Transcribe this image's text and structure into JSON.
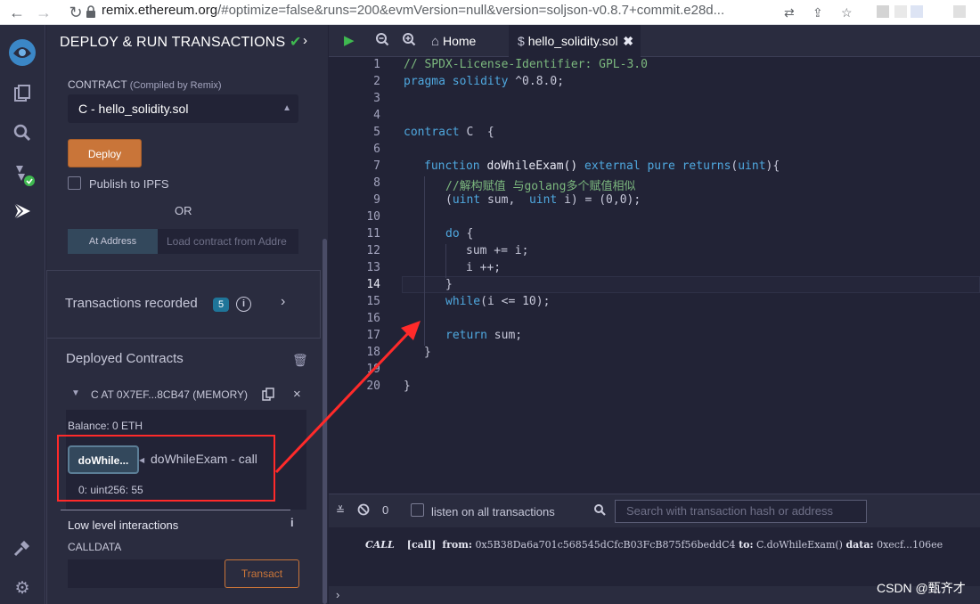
{
  "browser": {
    "url_host": "remix.ethereum.org",
    "url_rest": "/#optimize=false&runs=200&evmVersion=null&version=soljson-v0.8.7+commit.e28d..."
  },
  "panel": {
    "title": "DEPLOY & RUN TRANSACTIONS",
    "contract_label": "CONTRACT",
    "contract_sub": "(Compiled by Remix)",
    "contract_value": "C - hello_solidity.sol",
    "deploy_label": "Deploy",
    "publish_label": "Publish to IPFS",
    "or_label": "OR",
    "at_address_label": "At Address",
    "at_address_placeholder": "Load contract from Addre",
    "tx_recorded_label": "Transactions recorded",
    "tx_recorded_count": "5",
    "deployed_label": "Deployed Contracts",
    "instance_label": "C AT 0X7EF...8CB47 (MEMORY)",
    "balance_label": "Balance: 0 ETH",
    "call_button_label": "doWhile...",
    "call_desc": "doWhileExam - call",
    "call_result": "0: uint256: 55",
    "low_level_label": "Low level interactions",
    "calldata_label": "CALLDATA",
    "transact_label": "Transact"
  },
  "editor": {
    "home_tab": "Home",
    "file_tab": "hello_solidity.sol",
    "line_numbers": [
      "1",
      "2",
      "3",
      "4",
      "5",
      "6",
      "7",
      "8",
      "9",
      "10",
      "11",
      "12",
      "13",
      "14",
      "15",
      "16",
      "17",
      "18",
      "19",
      "20"
    ],
    "code": {
      "l1": "// SPDX-License-Identifier: GPL-3.0",
      "l2a": "pragma solidity",
      "l2b": " ^0.8.0;",
      "l5a": "contract",
      "l5b": " C  {",
      "l7a": "function",
      "l7b": " doWhileExam() ",
      "l7c": "external pure returns",
      "l7d": "(",
      "l7e": "uint",
      "l7f": "){",
      "l8": "//解构赋值 与golang多个赋值相似",
      "l9a": "(",
      "l9b": "uint",
      "l9c": " sum,  ",
      "l9d": "uint",
      "l9e": " i) = (0,0);",
      "l11a": "do",
      "l11b": " {",
      "l12": "sum += i;",
      "l13": "i ++;",
      "l14": "}",
      "l15a": "while",
      "l15b": "(i <= 10);",
      "l17a": "return",
      "l17b": " sum;",
      "l18": "}",
      "l20": "}"
    }
  },
  "terminal": {
    "count": "0",
    "listen_label": "listen on all transactions",
    "search_placeholder": "Search with transaction hash or address",
    "log_call": "CALL",
    "log_tag": "[call]",
    "log_from_label": "from:",
    "log_from": "0x5B38Da6a701c568545dCfcB03FcB875f56beddC4",
    "log_to_label": "to:",
    "log_to": "C.doWhileExam()",
    "log_data_label": "data:",
    "log_data": "0xecf...106ee"
  },
  "watermark": "CSDN @甄齐才",
  "colors": {
    "bg_dark": "#222336",
    "bg_panel": "#2a2c3f",
    "accent_orange": "#c97539",
    "keyword_blue": "#4fa8df",
    "comment_green": "#7cb87e",
    "annotation_red": "#ff2a2a"
  }
}
